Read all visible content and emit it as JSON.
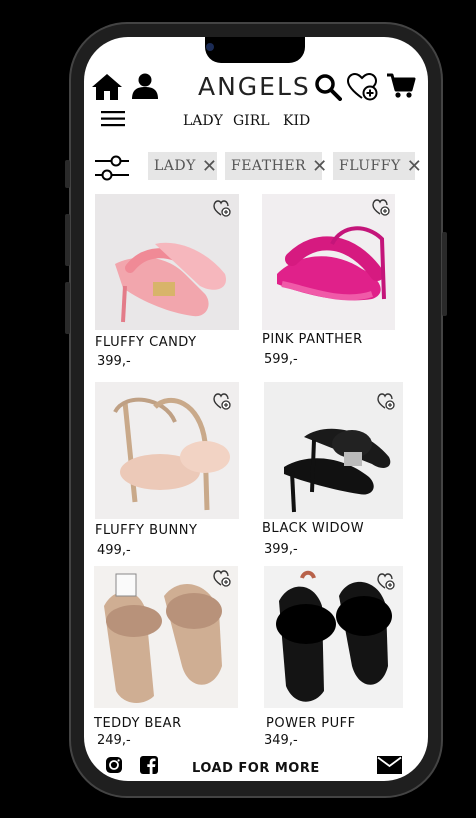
{
  "header": {
    "brand": "ANGELS",
    "icons": [
      "home-icon",
      "user-icon",
      "search-icon",
      "wishlist-icon",
      "cart-icon",
      "menu-icon"
    ]
  },
  "categories": [
    "LADY",
    "GIRL",
    "KID"
  ],
  "filters": [
    {
      "label": "LADY"
    },
    {
      "label": "FEATHER"
    },
    {
      "label": "FLUFFY"
    }
  ],
  "products": [
    {
      "name": "FLUFFY CANDY",
      "price": "399,-",
      "color": "#f3a0a8"
    },
    {
      "name": "PINK PANTHER",
      "price": "599,-",
      "color": "#e0218a"
    },
    {
      "name": "FLUFFY BUNNY",
      "price": "499,-",
      "color": "#e9c7b6"
    },
    {
      "name": "BLACK WIDOW",
      "price": "399,-",
      "color": "#111111"
    },
    {
      "name": "TEDDY BEAR",
      "price": "249,-",
      "color": "#c9a78f"
    },
    {
      "name": "POWER PUFF",
      "price": "349,-",
      "color": "#111111"
    }
  ],
  "footer": {
    "load_more": "LOAD FOR MORE",
    "icons": [
      "instagram-icon",
      "facebook-icon",
      "mail-icon"
    ]
  }
}
